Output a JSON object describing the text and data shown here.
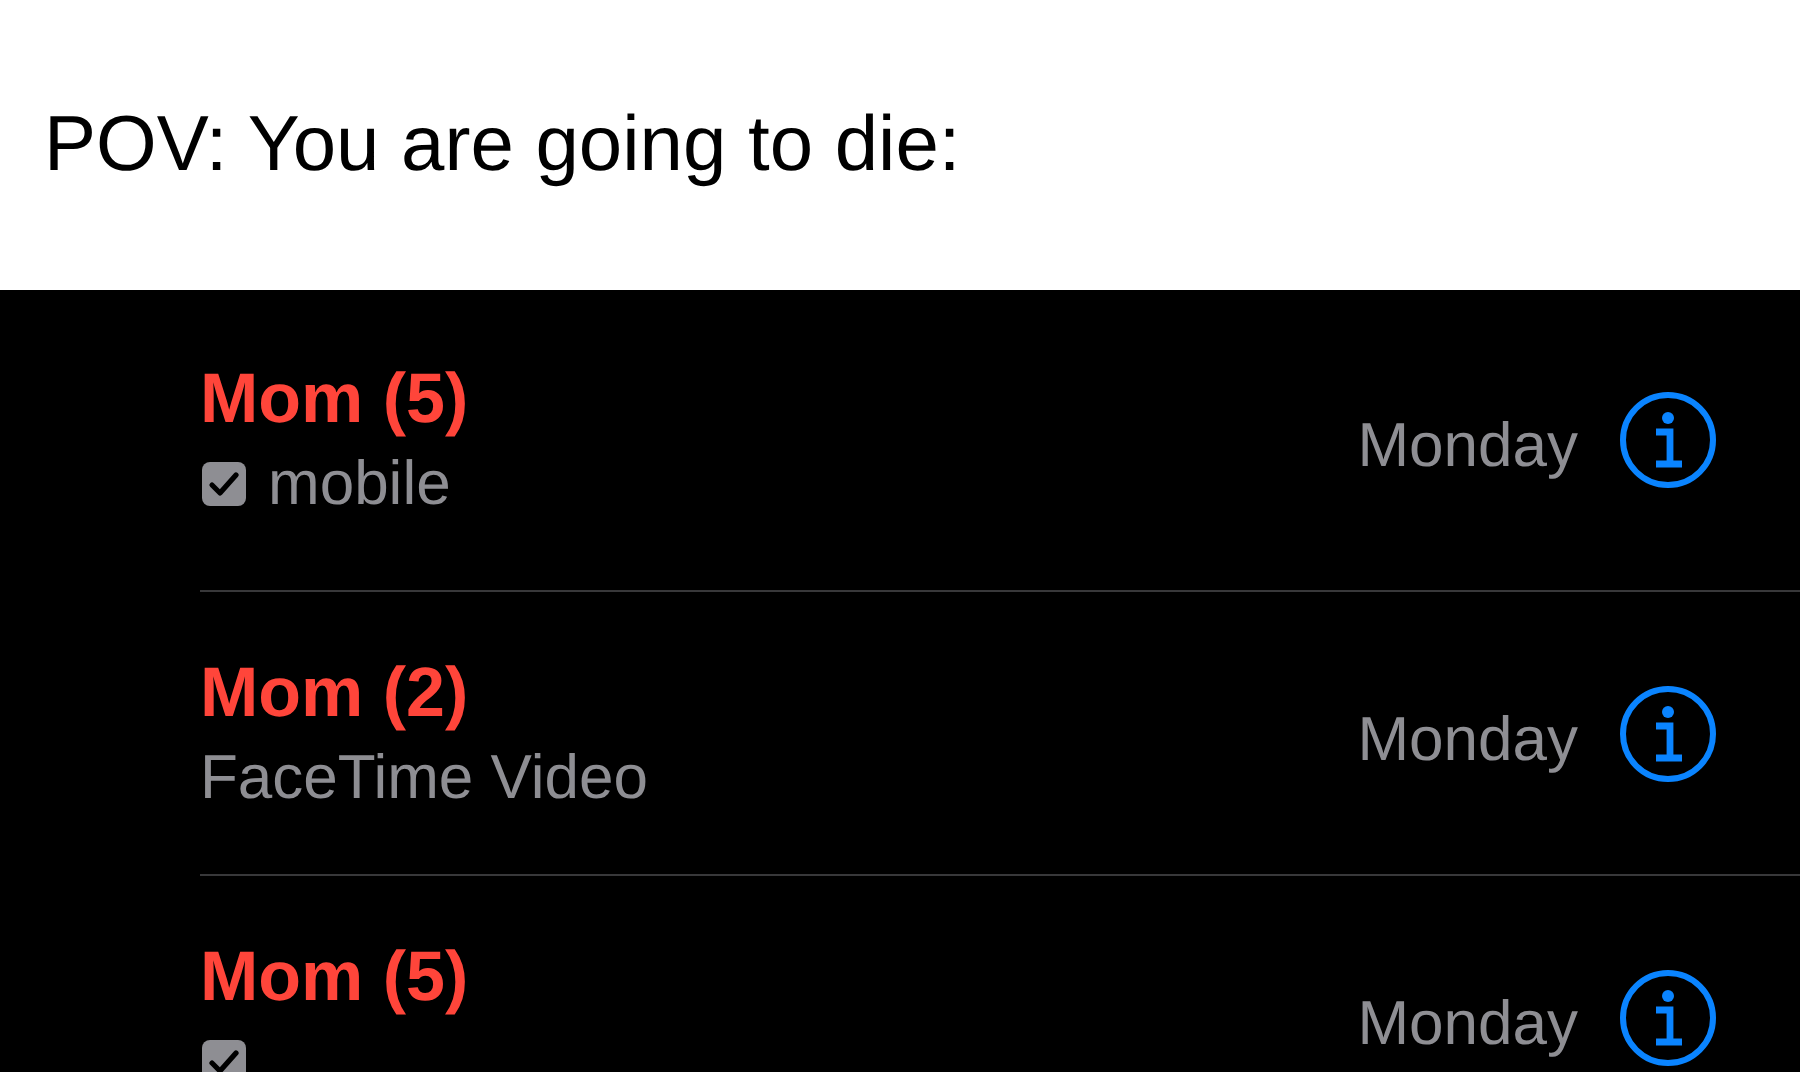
{
  "caption": "POV: You are going to die:",
  "calls": [
    {
      "name": "Mom (5)",
      "missed": true,
      "kind": "checkbox",
      "detail": "mobile",
      "date": "Monday"
    },
    {
      "name": "Mom (2)",
      "missed": true,
      "kind": "plain",
      "detail": "FaceTime Video",
      "date": "Monday"
    },
    {
      "name": "Mom (5)",
      "missed": true,
      "kind": "checkbox",
      "date": "Monday"
    }
  ]
}
